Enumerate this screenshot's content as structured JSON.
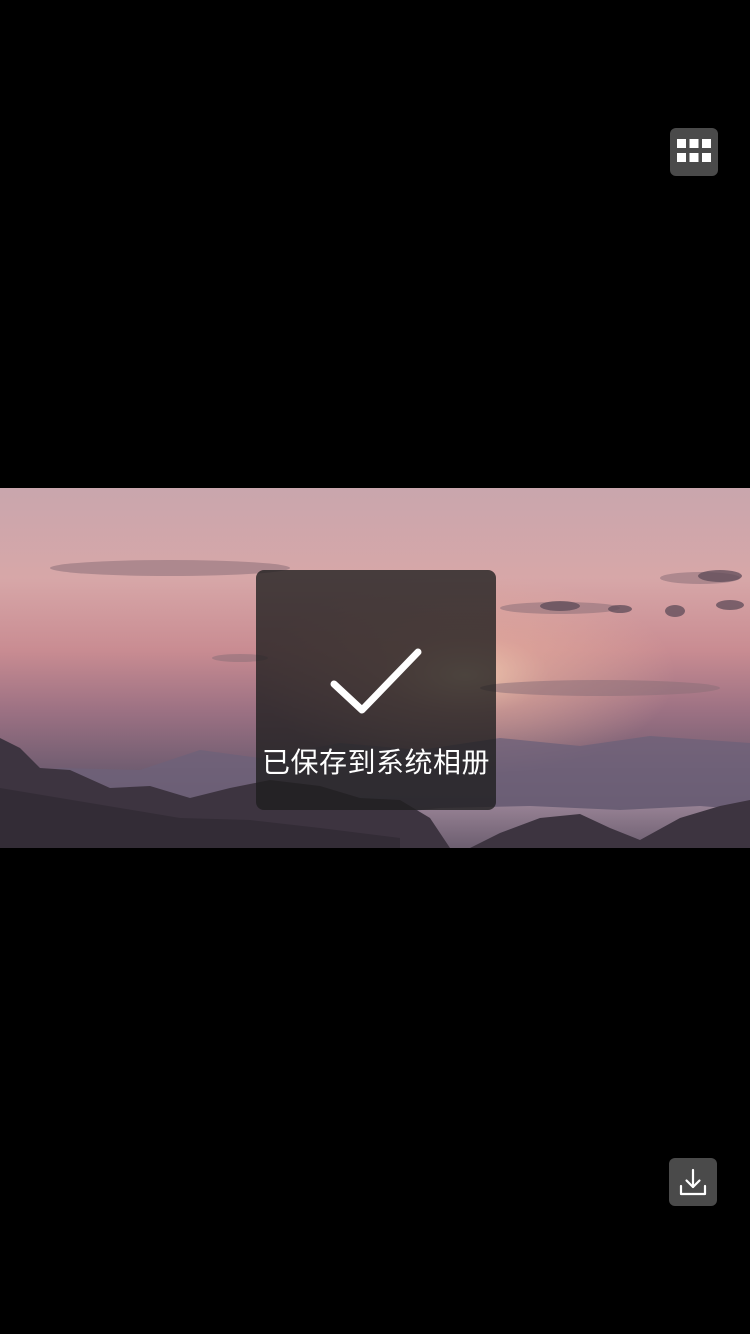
{
  "viewer": {
    "background": "#000000"
  },
  "controls": {
    "grid_icon": "grid-icon",
    "download_icon": "download-icon",
    "button_color": "#4a4a4a"
  },
  "photo": {
    "subject": "sunset-over-mountains"
  },
  "toast": {
    "icon": "checkmark-icon",
    "message": "已保存到系统相册"
  }
}
